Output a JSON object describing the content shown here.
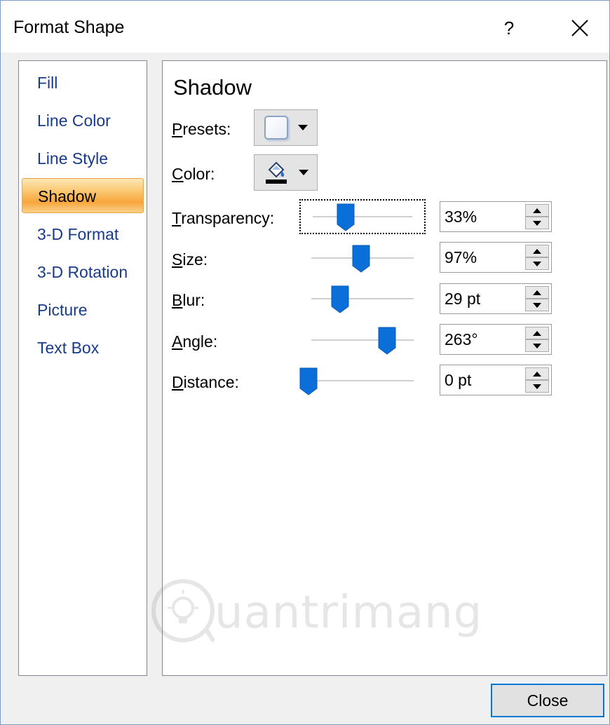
{
  "window": {
    "title": "Format Shape",
    "help_label": "?"
  },
  "sidebar": {
    "items": [
      {
        "label": "Fill",
        "active": false
      },
      {
        "label": "Line Color",
        "active": false
      },
      {
        "label": "Line Style",
        "active": false
      },
      {
        "label": "Shadow",
        "active": true
      },
      {
        "label": "3-D Format",
        "active": false
      },
      {
        "label": "3-D Rotation",
        "active": false
      },
      {
        "label": "Picture",
        "active": false
      },
      {
        "label": "Text Box",
        "active": false
      }
    ]
  },
  "shadow": {
    "title": "Shadow",
    "presets": {
      "label_key": "P",
      "label_rest": "resets:"
    },
    "color": {
      "label_key": "C",
      "label_rest": "olor:",
      "swatch": "#000000"
    },
    "rows": [
      {
        "label_key": "T",
        "label_rest": "ransparency:",
        "value": "33%",
        "slider_level": 0.33
      },
      {
        "label_key": "S",
        "label_rest": "ize:",
        "value": "97%",
        "slider_level": 0.485
      },
      {
        "label_key": "B",
        "label_rest": "lur:",
        "value": "29 pt",
        "slider_level": 0.29
      },
      {
        "label_key": "A",
        "label_rest": "ngle:",
        "value": "263°",
        "slider_level": 0.73
      },
      {
        "label_key": "D",
        "label_rest": "istance:",
        "value": "0 pt",
        "slider_level": 0.0
      }
    ]
  },
  "watermark": {
    "text": "uantrimang"
  },
  "footer": {
    "close_label": "Close"
  },
  "colors": {
    "accent": "#0078d7",
    "active_tab": "#f7a53b",
    "nav_text": "#1a3a8a"
  }
}
